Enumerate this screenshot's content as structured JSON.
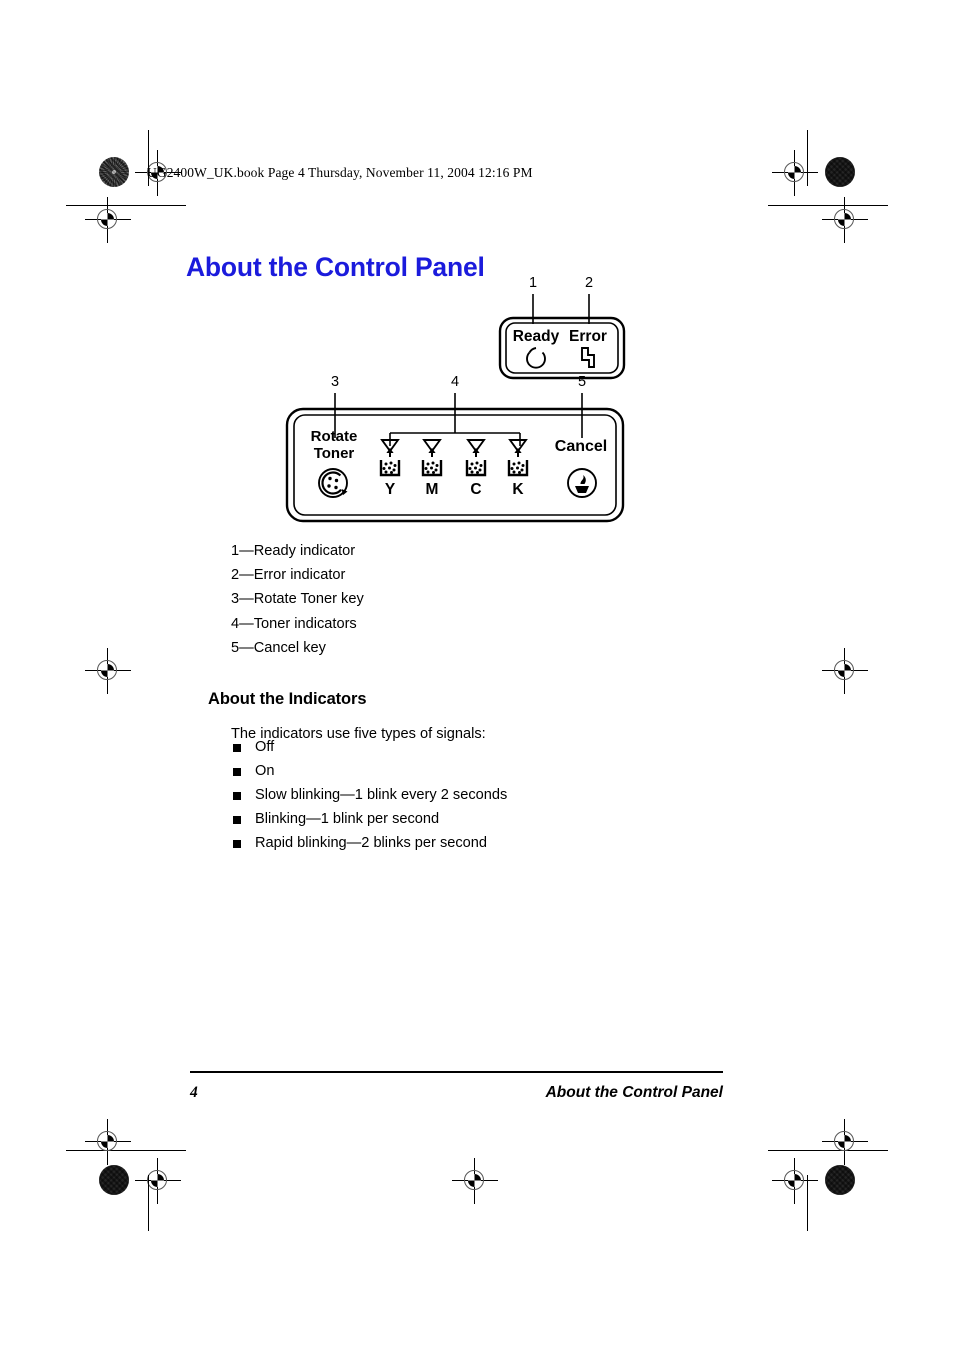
{
  "document": {
    "slug": "UG2400W_UK.book  Page 4  Thursday, November 11, 2004  12:16 PM",
    "title": "About the Control Panel",
    "title_color": "#1b1bdc"
  },
  "figure": {
    "status_panel": {
      "ready_label": "Ready",
      "error_label": "Error",
      "callouts": [
        "1",
        "2"
      ]
    },
    "main_panel": {
      "rotate_label_line1": "Rotate",
      "rotate_label_line2": "Toner",
      "cancel_label": "Cancel",
      "toner_labels": [
        "Y",
        "M",
        "C",
        "K"
      ],
      "callouts": [
        "3",
        "4",
        "5"
      ]
    }
  },
  "legend": {
    "items": [
      "1—Ready indicator",
      "2—Error indicator",
      "3—Rotate Toner key",
      "4—Toner indicators",
      "5—Cancel key"
    ]
  },
  "indicators_section": {
    "heading": "About the Indicators",
    "intro": "The indicators use five types of signals:",
    "bullets": [
      "Off",
      "On",
      "Slow blinking—1 blink every 2 seconds",
      "Blinking—1 blink per second",
      "Rapid blinking—2 blinks per second"
    ]
  },
  "footer": {
    "page_number": "4",
    "running_title": "About the Control Panel"
  }
}
